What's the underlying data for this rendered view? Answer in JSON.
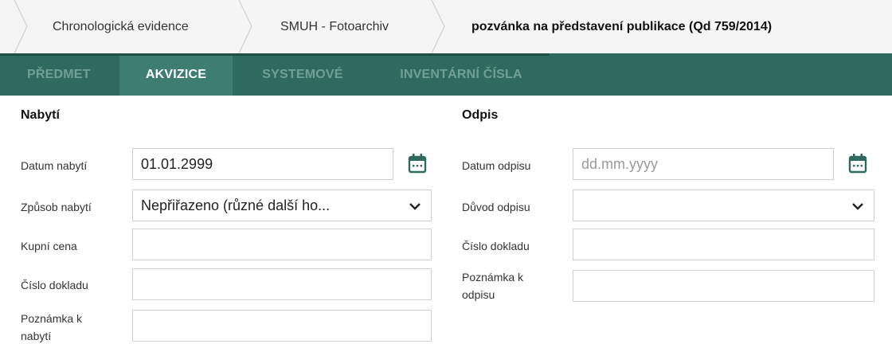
{
  "breadcrumb": {
    "items": [
      {
        "label": "Chronologická evidence"
      },
      {
        "label": "SMUH - Fotoarchiv"
      },
      {
        "label": "pozvánka na představení publikace (Qd 759/2014)"
      }
    ]
  },
  "tabs": [
    {
      "label": "PŘEDMET",
      "active": false
    },
    {
      "label": "AKVIZICE",
      "active": true
    },
    {
      "label": "SYSTEMOVÉ",
      "active": false
    },
    {
      "label": "INVENTÁRNÍ ČÍSLA",
      "active": false
    }
  ],
  "acquisition": {
    "title": "Nabytí",
    "date_label": "Datum nabytí",
    "date_value": "01.01.2999",
    "method_label": "Způsob nabytí",
    "method_value": "Nepřiřazeno (různé další ho...",
    "price_label": "Kupní cena",
    "price_value": "",
    "doc_label": "Číslo dokladu",
    "doc_value": "",
    "note_label_1": "Poznámka k",
    "note_label_2": "nabytí",
    "note_value": ""
  },
  "writeoff": {
    "title": "Odpis",
    "date_label": "Datum odpisu",
    "date_placeholder": "dd.mm.yyyy",
    "reason_label": "Důvod odpisu",
    "reason_value": "",
    "doc_label": "Číslo dokladu",
    "doc_value": "",
    "note_label_1": "Poznámka k",
    "note_label_2": "odpisu",
    "note_value": ""
  },
  "colors": {
    "tab_bar": "#2e6b5e",
    "tab_active": "#3e7e71",
    "accent_icon": "#2e6b5e"
  }
}
